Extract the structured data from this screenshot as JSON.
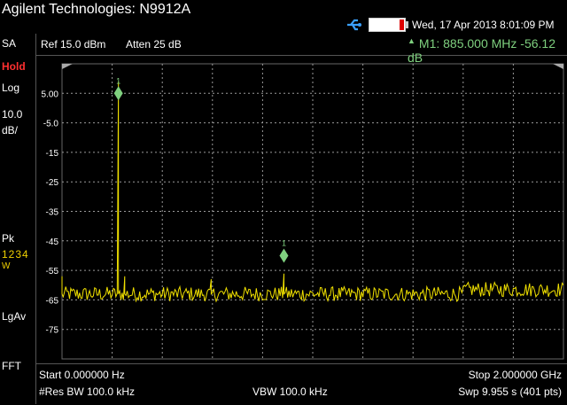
{
  "title": "Agilent Technologies: N9912A",
  "status": {
    "datetime": "Wed, 17 Apr 2013 8:01:09 PM",
    "usb_icon": "usb-icon",
    "battery_icon": "battery-icon"
  },
  "left_panel": {
    "mode": "SA",
    "hold": "Hold",
    "scale_type": "Log",
    "scale_value": "10.0",
    "scale_unit": "dB/",
    "detector": "Pk",
    "traces": "1234",
    "trace_mode": "W",
    "lgav": "LgAv",
    "fft": "FFT"
  },
  "ref_bar": {
    "ref": "Ref 15.0 dBm",
    "atten": "Atten 25 dB",
    "marker": "M1:  885.000 MHz  -56.12 dB"
  },
  "bottom_bar": {
    "start": "Start 0.000000  Hz",
    "stop": "Stop 2.000000 GHz",
    "rbw": "#Res BW 100.0 kHz",
    "vbw": "VBW 100.0 kHz",
    "sweep": "Swp 9.955  s (401 pts)"
  },
  "chart_data": {
    "type": "line",
    "xlabel": "",
    "ylabel": "",
    "xlim": [
      0,
      2000
    ],
    "ylim": [
      -85,
      15
    ],
    "y_ticks": [
      "5.00",
      "-5.0",
      "-15",
      "-25",
      "-35",
      "-45",
      "-55",
      "-65",
      "-75"
    ],
    "grid": true,
    "noise_floor_db": -63,
    "peaks": [
      {
        "x_mhz": 0,
        "y_db": -57
      },
      {
        "x_mhz": 225,
        "y_db": 9
      },
      {
        "x_mhz": 250,
        "y_db": -57
      },
      {
        "x_mhz": 595,
        "y_db": -58
      },
      {
        "x_mhz": 885,
        "y_db": -56.12
      }
    ],
    "markers": [
      {
        "label": "1",
        "x_mhz": 225,
        "y_db": 5
      },
      {
        "label": "1",
        "x_mhz": 885,
        "y_db": -50
      }
    ]
  }
}
